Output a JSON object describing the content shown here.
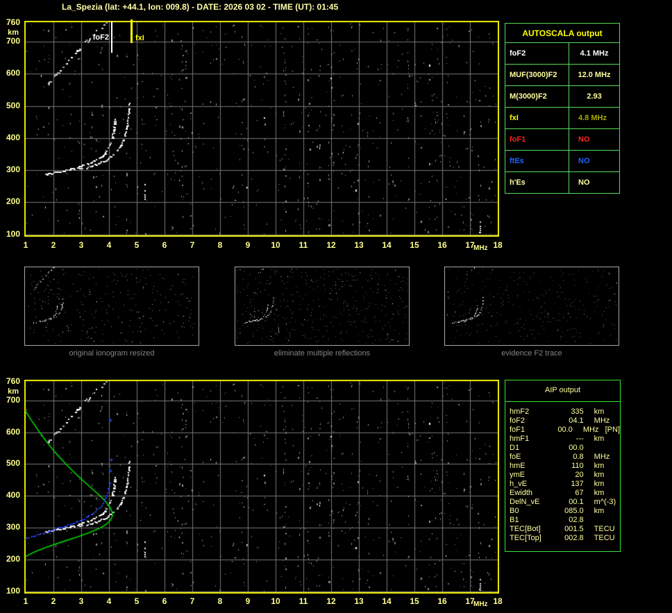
{
  "title": "La_Spezia (lat: +44.1, lon: 009.8) - DATE: 2026 03 02 - TIME (UT): 01:45",
  "axes": {
    "y_unit": "km",
    "x_unit": "MHz",
    "y_ticks": [
      "760",
      "700",
      "600",
      "500",
      "400",
      "300",
      "200",
      "100"
    ],
    "x_ticks": [
      "1",
      "2",
      "3",
      "4",
      "5",
      "6",
      "7",
      "8",
      "9",
      "10",
      "11",
      "12",
      "13",
      "14",
      "15",
      "16",
      "17",
      "18"
    ]
  },
  "top_plot": {
    "foF2_label": "foF2",
    "fxI_label": "fxI",
    "foF2_mhz": 4.1,
    "fxI_mhz": 4.8
  },
  "autoscala": {
    "title": "AUTOSCALA output",
    "rows": [
      {
        "label": "foF2",
        "value": "4.1 MHz",
        "label_color": "#ffffff",
        "value_color": "#ffffff"
      },
      {
        "label": "MUF(3000)F2",
        "value": "12.0 MHz",
        "label_color": "#ffff9e",
        "value_color": "#ffff9e"
      },
      {
        "label": "M(3000)F2",
        "value": "2.93",
        "label_color": "#ffff9e",
        "value_color": "#ffff9e"
      },
      {
        "label": "fxI",
        "value": "4.8 MHz",
        "label_color": "#ffff00",
        "value_color": "#a9a900"
      },
      {
        "label": "foF1",
        "value": "NO",
        "label_color": "#ff2020",
        "value_color": "#ff2020"
      },
      {
        "label": "ftEs",
        "value": "NO",
        "label_color": "#2064ff",
        "value_color": "#2064ff"
      },
      {
        "label": "h'Es",
        "value": "NO",
        "label_color": "#ffff9e",
        "value_color": "#ffff9e"
      }
    ]
  },
  "thumbnails": [
    {
      "caption": "original ionogram resized"
    },
    {
      "caption": "eliminate multiple reflections"
    },
    {
      "caption": "evidence F2 trace"
    }
  ],
  "aip": {
    "title": "AIP output",
    "rows": [
      {
        "label": "hmF2",
        "value": "335",
        "unit": "km",
        "extra": ""
      },
      {
        "label": "foF2",
        "value": "04.1",
        "unit": "MHz",
        "extra": ""
      },
      {
        "label": "foF1",
        "value": "00.0",
        "unit": "MHz",
        "extra": "[PN]"
      },
      {
        "label": "hmF1",
        "value": "---",
        "unit": "km",
        "extra": ""
      },
      {
        "label": "D1",
        "value": "00.0",
        "unit": "",
        "extra": ""
      },
      {
        "label": "foE",
        "value": "0.8",
        "unit": "MHz",
        "extra": ""
      },
      {
        "label": "hmE",
        "value": "110",
        "unit": "km",
        "extra": ""
      },
      {
        "label": "ymE",
        "value": "20",
        "unit": "km",
        "extra": ""
      },
      {
        "label": "h_vE",
        "value": "137",
        "unit": "km",
        "extra": ""
      },
      {
        "label": "Ewidth",
        "value": "67",
        "unit": "km",
        "extra": ""
      },
      {
        "label": "DelN_vE",
        "value": "00.1",
        "unit": "m^(-3)",
        "extra": ""
      },
      {
        "label": "B0",
        "value": "085.0",
        "unit": "km",
        "extra": ""
      },
      {
        "label": "B1",
        "value": "02.8",
        "unit": "",
        "extra": ""
      },
      {
        "label": "TEC[Bot]",
        "value": "001.5",
        "unit": "TECU",
        "extra": ""
      },
      {
        "label": "TEC[Top]",
        "value": "002.8",
        "unit": "TECU",
        "extra": ""
      }
    ]
  },
  "plot_content": {
    "x_range_mhz": [
      1,
      18
    ],
    "y_range_km": [
      100,
      760
    ],
    "o_trace": [
      [
        1.72,
        287
      ],
      [
        2.05,
        293
      ],
      [
        2.4,
        299
      ],
      [
        2.75,
        306
      ],
      [
        3.1,
        315
      ],
      [
        3.4,
        325
      ],
      [
        3.65,
        337
      ],
      [
        3.85,
        352
      ],
      [
        4.0,
        372
      ],
      [
        4.1,
        396
      ],
      [
        4.16,
        422
      ],
      [
        4.2,
        448
      ],
      [
        4.21,
        462
      ]
    ],
    "x_trace": [
      [
        2.95,
        303
      ],
      [
        3.25,
        310
      ],
      [
        3.55,
        318
      ],
      [
        3.85,
        329
      ],
      [
        4.1,
        343
      ],
      [
        4.3,
        360
      ],
      [
        4.45,
        381
      ],
      [
        4.57,
        407
      ],
      [
        4.65,
        436
      ],
      [
        4.7,
        468
      ],
      [
        4.73,
        497
      ],
      [
        4.74,
        514
      ]
    ],
    "diagonal_trace": [
      [
        1.82,
        572
      ],
      [
        2.05,
        594
      ],
      [
        2.3,
        618
      ],
      [
        2.55,
        641
      ],
      [
        2.8,
        664
      ],
      [
        3.05,
        688
      ],
      [
        3.3,
        710
      ],
      [
        3.55,
        731
      ],
      [
        3.78,
        750
      ],
      [
        3.95,
        762
      ]
    ],
    "e_streak": {
      "mhz": 5.27,
      "km_range": [
        205,
        255
      ]
    },
    "hf_streak": {
      "mhz": 17.35,
      "km_range": [
        103,
        138
      ]
    },
    "green_profile": [
      [
        1.0,
        668
      ],
      [
        1.2,
        640
      ],
      [
        1.45,
        608
      ],
      [
        1.75,
        572
      ],
      [
        2.1,
        534
      ],
      [
        2.5,
        496
      ],
      [
        2.9,
        462
      ],
      [
        3.3,
        430
      ],
      [
        3.65,
        403
      ],
      [
        3.9,
        381
      ],
      [
        4.05,
        363
      ],
      [
        4.12,
        348
      ],
      [
        4.13,
        337
      ],
      [
        4.07,
        324
      ],
      [
        3.92,
        311
      ],
      [
        3.65,
        297
      ],
      [
        3.3,
        284
      ],
      [
        2.85,
        270
      ],
      [
        2.35,
        256
      ],
      [
        1.85,
        241
      ],
      [
        1.45,
        228
      ],
      [
        1.15,
        216
      ],
      [
        1.0,
        208
      ]
    ],
    "blue_trace": [
      [
        1.0,
        266
      ],
      [
        1.35,
        276
      ],
      [
        1.7,
        285
      ],
      [
        2.05,
        295
      ],
      [
        2.4,
        305
      ],
      [
        2.75,
        316
      ],
      [
        3.05,
        327
      ],
      [
        3.3,
        339
      ],
      [
        3.52,
        352
      ],
      [
        3.7,
        367
      ],
      [
        3.84,
        384
      ],
      [
        3.94,
        404
      ],
      [
        4.0,
        426
      ],
      [
        4.04,
        448
      ]
    ],
    "blue_marks": [
      [
        4.06,
        478
      ],
      [
        4.09,
        512
      ],
      [
        4.08,
        638
      ]
    ]
  },
  "colors": {
    "background": "#000000",
    "frame_yellow": "#f0f000",
    "grid": "#787878",
    "pale_yellow": "#ffff9e",
    "autoscala_border": "#58dc58",
    "aip_border": "#35e635",
    "caption_gray": "#858585",
    "green_profile": "#00d800",
    "blue_trace": "#2b47ff",
    "foF2_marker": "#ffffff",
    "fxI_marker": "#ffff00"
  }
}
